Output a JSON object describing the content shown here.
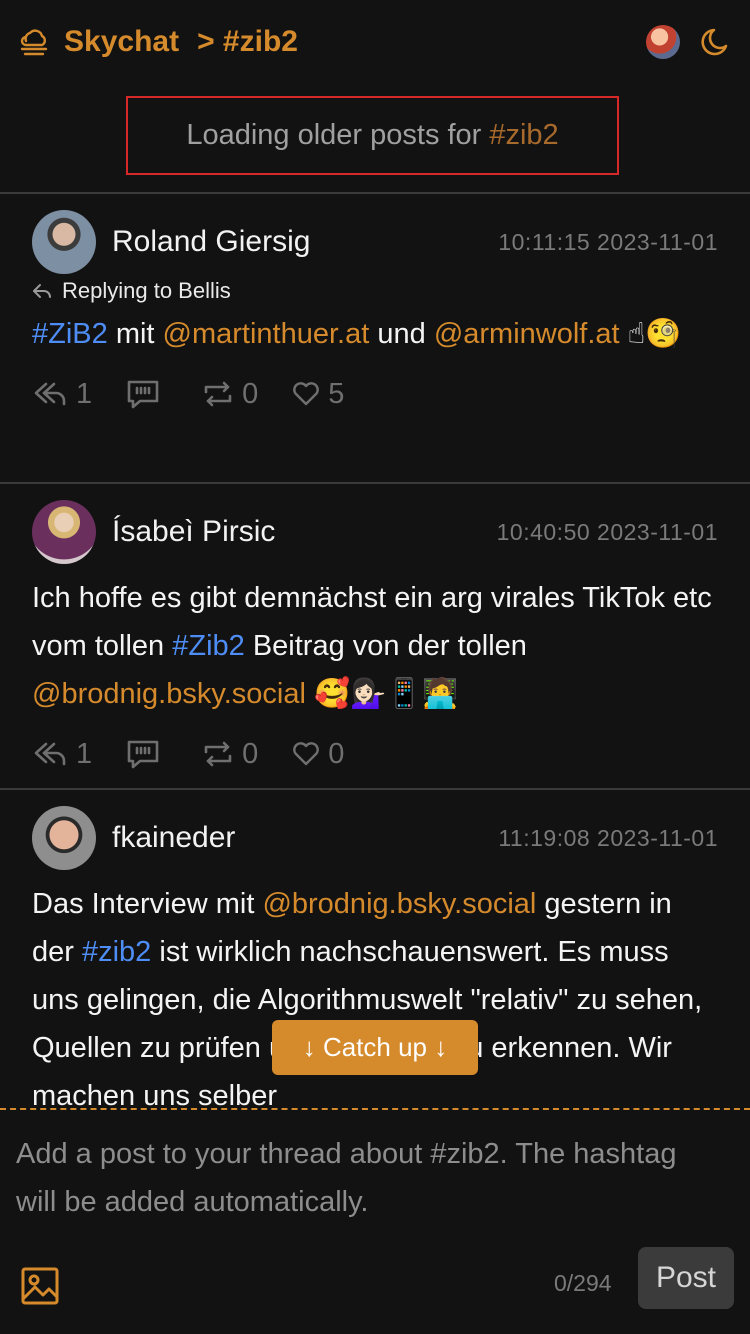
{
  "header": {
    "app_name": "Skychat",
    "breadcrumb": "> #zib2"
  },
  "banner": {
    "prefix": "Loading older posts for",
    "tag": "#zib2"
  },
  "posts": [
    {
      "author": "Roland Giersig",
      "time": "10:11:15 2023-11-01",
      "reply_to": "Replying to Bellis",
      "text_parts": [
        {
          "t": "#ZiB2",
          "type": "tag"
        },
        {
          "t": " mit ",
          "type": "plain"
        },
        {
          "t": "@martinthuer.at",
          "type": "mention"
        },
        {
          "t": " und ",
          "type": "plain"
        },
        {
          "t": "@arminwolf.at",
          "type": "mention"
        },
        {
          "t": " ☝🧐",
          "type": "plain"
        }
      ],
      "replies": "1",
      "reposts": "0",
      "likes": "5"
    },
    {
      "author": "Ísabeì Pirsic",
      "time": "10:40:50 2023-11-01",
      "text_parts": [
        {
          "t": "Ich hoffe es gibt demnächst ein arg virales TikTok etc vom tollen ",
          "type": "plain"
        },
        {
          "t": "#Zib2",
          "type": "tag"
        },
        {
          "t": " Beitrag von der tollen ",
          "type": "plain"
        },
        {
          "t": "@brodnig.bsky.social",
          "type": "mention"
        },
        {
          "t": " 🥰💁🏻‍♀️📱🧑‍💻",
          "type": "plain"
        }
      ],
      "replies": "1",
      "reposts": "0",
      "likes": "0"
    },
    {
      "author": "fkaineder",
      "time": "11:19:08 2023-11-01",
      "text_parts": [
        {
          "t": "Das Interview mit ",
          "type": "plain"
        },
        {
          "t": "@brodnig.bsky.social",
          "type": "mention"
        },
        {
          "t": " gestern in der ",
          "type": "plain"
        },
        {
          "t": "#zib2",
          "type": "tag"
        },
        {
          "t": " ist wirklich nachschauenswert. Es muss uns gelingen, die Algorithmuswelt \"relativ\" zu sehen, Quellen zu prüfen und Fake klar zu erkennen. Wir machen uns selber",
          "type": "plain"
        }
      ]
    }
  ],
  "catch_up": "↓ Catch up ↓",
  "composer": {
    "placeholder": "Add a post to your thread about #zib2. The hashtag will be added automatically.",
    "count": "0/294",
    "post_label": "Post"
  },
  "colors": {
    "accent": "#d58a2c",
    "tag": "#4e8df5",
    "background": "#121212",
    "highlight_border": "#d62828"
  }
}
